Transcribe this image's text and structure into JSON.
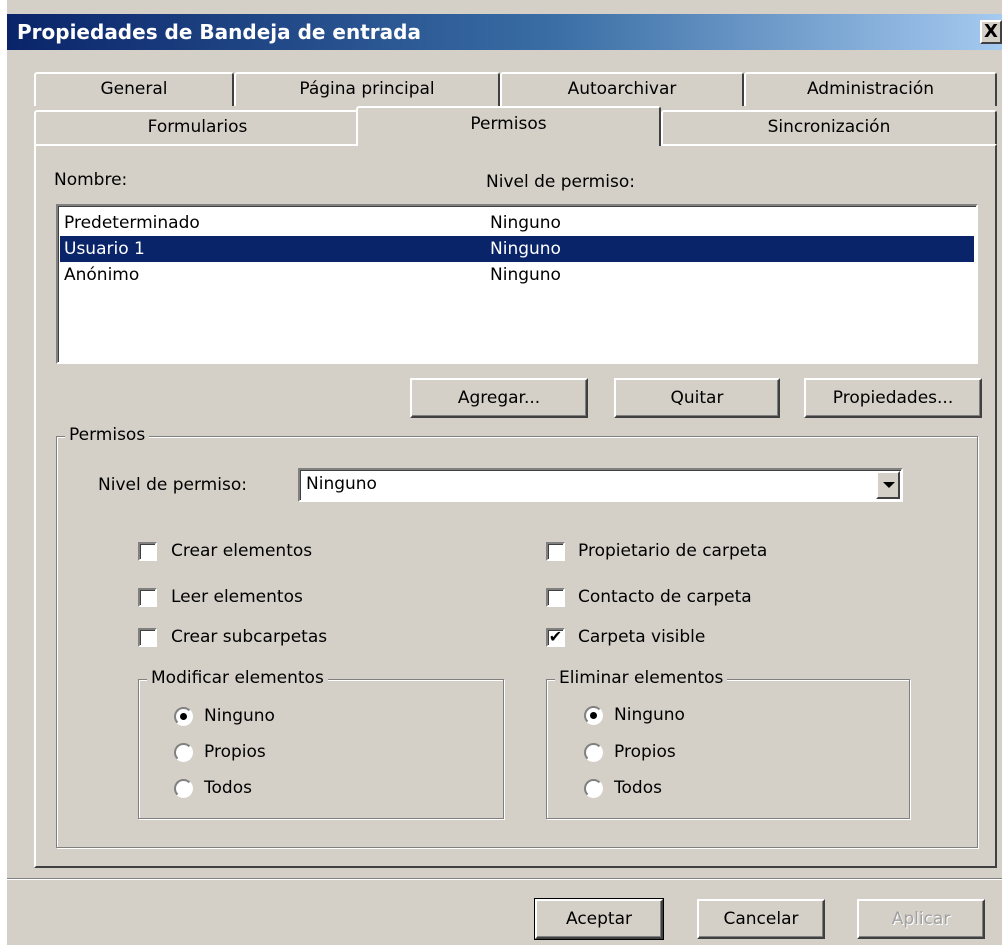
{
  "window": {
    "title": "Propiedades de Bandeja de entrada",
    "close": "X"
  },
  "tabs_back": [
    "General",
    "Página principal",
    "Autoarchivar",
    "Administración"
  ],
  "tabs_front": [
    "Formularios",
    "Permisos",
    "Sincronización"
  ],
  "active_tab": "Permisos",
  "list": {
    "header_name": "Nombre:",
    "header_level": "Nivel de permiso:",
    "rows": [
      {
        "name": "Predeterminado",
        "level": "Ninguno",
        "selected": false
      },
      {
        "name": "Usuario 1",
        "level": "Ninguno",
        "selected": true
      },
      {
        "name": "Anónimo",
        "level": "Ninguno",
        "selected": false
      }
    ]
  },
  "list_buttons": {
    "add": "Agregar...",
    "remove": "Quitar",
    "properties": "Propiedades..."
  },
  "permissions": {
    "group_title": "Permisos",
    "level_label": "Nivel de permiso:",
    "level_value": "Ninguno",
    "checkboxes": {
      "create_items": {
        "label": "Crear elementos",
        "checked": false
      },
      "read_items": {
        "label": "Leer elementos",
        "checked": false
      },
      "create_subfolders": {
        "label": "Crear subcarpetas",
        "checked": false
      },
      "folder_owner": {
        "label": "Propietario de carpeta",
        "checked": false
      },
      "folder_contact": {
        "label": "Contacto de carpeta",
        "checked": false
      },
      "folder_visible": {
        "label": "Carpeta visible",
        "checked": true
      }
    },
    "edit_items": {
      "title": "Modificar elementos",
      "options": [
        "Ninguno",
        "Propios",
        "Todos"
      ],
      "selected": "Ninguno"
    },
    "delete_items": {
      "title": "Eliminar elementos",
      "options": [
        "Ninguno",
        "Propios",
        "Todos"
      ],
      "selected": "Ninguno"
    }
  },
  "footer_buttons": {
    "ok": "Aceptar",
    "cancel": "Cancelar",
    "apply": "Aplicar"
  },
  "icons": {
    "check_mark": "✔"
  },
  "colors": {
    "titlebar": "#0a246a",
    "selection": "#0a246a",
    "face": "#d4d0c8"
  }
}
